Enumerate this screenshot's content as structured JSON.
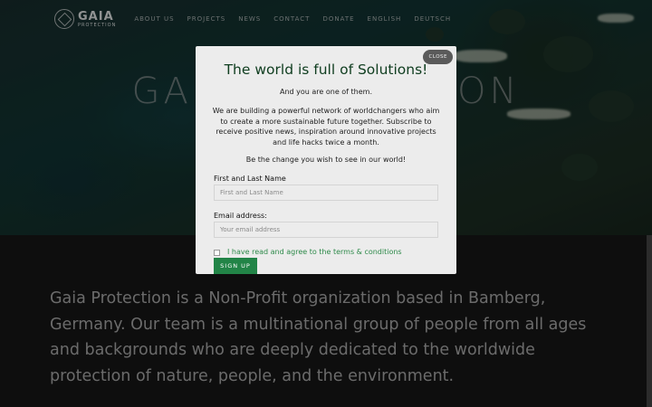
{
  "nav": {
    "logo": {
      "name": "GAIA",
      "tagline": "PROTECTION"
    },
    "items": [
      "ABOUT US",
      "PROJECTS",
      "NEWS",
      "CONTACT",
      "DONATE",
      "ENGLISH",
      "DEUTSCH"
    ]
  },
  "hero": {
    "title": "GAIA PROTECTION"
  },
  "about": {
    "text": "Gaia Protection is a Non-Profit organization based in Bamberg, Germany. Our team is a multinational group of people from all ages and backgrounds who are deeply dedicated to the worldwide protection of nature, people, and the environment."
  },
  "modal": {
    "close_label": "CLOSE",
    "title": "The world is full of Solutions!",
    "subtitle": "And you are one of them.",
    "body": "We are building a powerful network of worldchangers who aim to create a more sustainable future together. Subscribe to receive positive news, inspiration around innovative projects and life hacks twice a month.",
    "call": "Be the change you wish to see in our world!",
    "name_label": "First and Last Name",
    "name_placeholder": "First and Last Name",
    "email_label": "Email address:",
    "email_placeholder": "Your email address",
    "terms": "I have read and agree to the terms & conditions",
    "signup_label": "SIGN UP"
  }
}
